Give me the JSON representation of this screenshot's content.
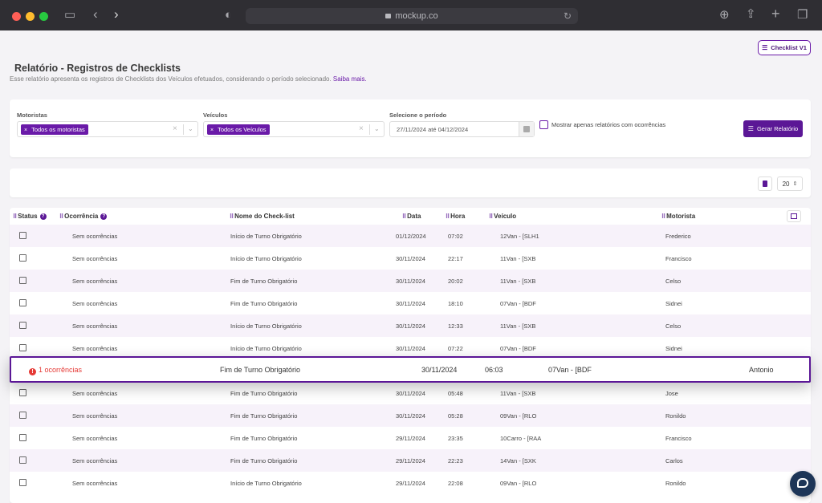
{
  "browser": {
    "url": "mockup.co"
  },
  "header": {
    "checklist_button": "Checklist V1",
    "title": "Relatório - Registros de Checklists",
    "subtitle": "Esse relatório apresenta os registros de Checklists dos Veículos efetuados, considerando o período selecionado.",
    "learn_more": "Saiba mais."
  },
  "filters": {
    "drivers_label": "Motoristas",
    "drivers_tag": "Todos os motoristas",
    "vehicles_label": "Veículos",
    "vehicles_tag": "Todos os Veículos",
    "period_label": "Selecione o período",
    "period_value": "27/11/2024  até 04/12/2024",
    "only_occurrences_label": "Mostrar apenas relatórios com ocorrências",
    "generate_button": "Gerar Relatório"
  },
  "toolbar": {
    "per_page": "20"
  },
  "table": {
    "columns": [
      "Status",
      "Ocorrência",
      "Nome do Check-list",
      "Data",
      "Hora",
      "Veículo",
      "Motorista"
    ],
    "rows": [
      {
        "occ": "Sem ocorrências",
        "name": "Início de Turno Obrigatório",
        "date": "01/12/2024",
        "time": "07:02",
        "vehicle": "12Van - [SLH1",
        "driver": "Frederico"
      },
      {
        "occ": "Sem ocorrências",
        "name": "Início de Turno Obrigatório",
        "date": "30/11/2024",
        "time": "22:17",
        "vehicle": "11Van - [SXB",
        "driver": "Francisco"
      },
      {
        "occ": "Sem ocorrências",
        "name": "Fim de Turno Obrigatório",
        "date": "30/11/2024",
        "time": "20:02",
        "vehicle": "11Van - [SXB",
        "driver": "Celso"
      },
      {
        "occ": "Sem ocorrências",
        "name": "Fim de Turno Obrigatório",
        "date": "30/11/2024",
        "time": "18:10",
        "vehicle": "07Van - [BDF",
        "driver": "Sidnei"
      },
      {
        "occ": "Sem ocorrências",
        "name": "Início de Turno Obrigatório",
        "date": "30/11/2024",
        "time": "12:33",
        "vehicle": "11Van - [SXB",
        "driver": "Celso"
      },
      {
        "occ": "Sem ocorrências",
        "name": "Início de Turno Obrigatório",
        "date": "30/11/2024",
        "time": "07:22",
        "vehicle": "07Van - [BDF",
        "driver": "Sidnei"
      },
      {
        "occ": "",
        "name": "",
        "date": "",
        "time": "",
        "vehicle": "",
        "driver": ""
      },
      {
        "occ": "Sem ocorrências",
        "name": "Fim de Turno Obrigatório",
        "date": "30/11/2024",
        "time": "05:48",
        "vehicle": "11Van - [SXB",
        "driver": "Jose"
      },
      {
        "occ": "Sem ocorrências",
        "name": "Fim de Turno Obrigatório",
        "date": "30/11/2024",
        "time": "05:28",
        "vehicle": "09Van - [RLO",
        "driver": "Ronildo"
      },
      {
        "occ": "Sem ocorrências",
        "name": "Fim de Turno Obrigatório",
        "date": "29/11/2024",
        "time": "23:35",
        "vehicle": "10Carro - [RAA",
        "driver": "Francisco"
      },
      {
        "occ": "Sem ocorrências",
        "name": "Fim de Turno Obrigatório",
        "date": "29/11/2024",
        "time": "22:23",
        "vehicle": "14Van - [SXK",
        "driver": "Carlos"
      },
      {
        "occ": "Sem ocorrências",
        "name": "Início de Turno Obrigatório",
        "date": "29/11/2024",
        "time": "22:08",
        "vehicle": "09Van - [RLO",
        "driver": "Ronildo"
      }
    ],
    "highlighted": {
      "occ": "1 ocorrências",
      "name": "Fim de Turno Obrigatório",
      "date": "30/11/2024",
      "time": "06:03",
      "vehicle": "07Van - [BDF",
      "driver": "Antonio"
    }
  }
}
